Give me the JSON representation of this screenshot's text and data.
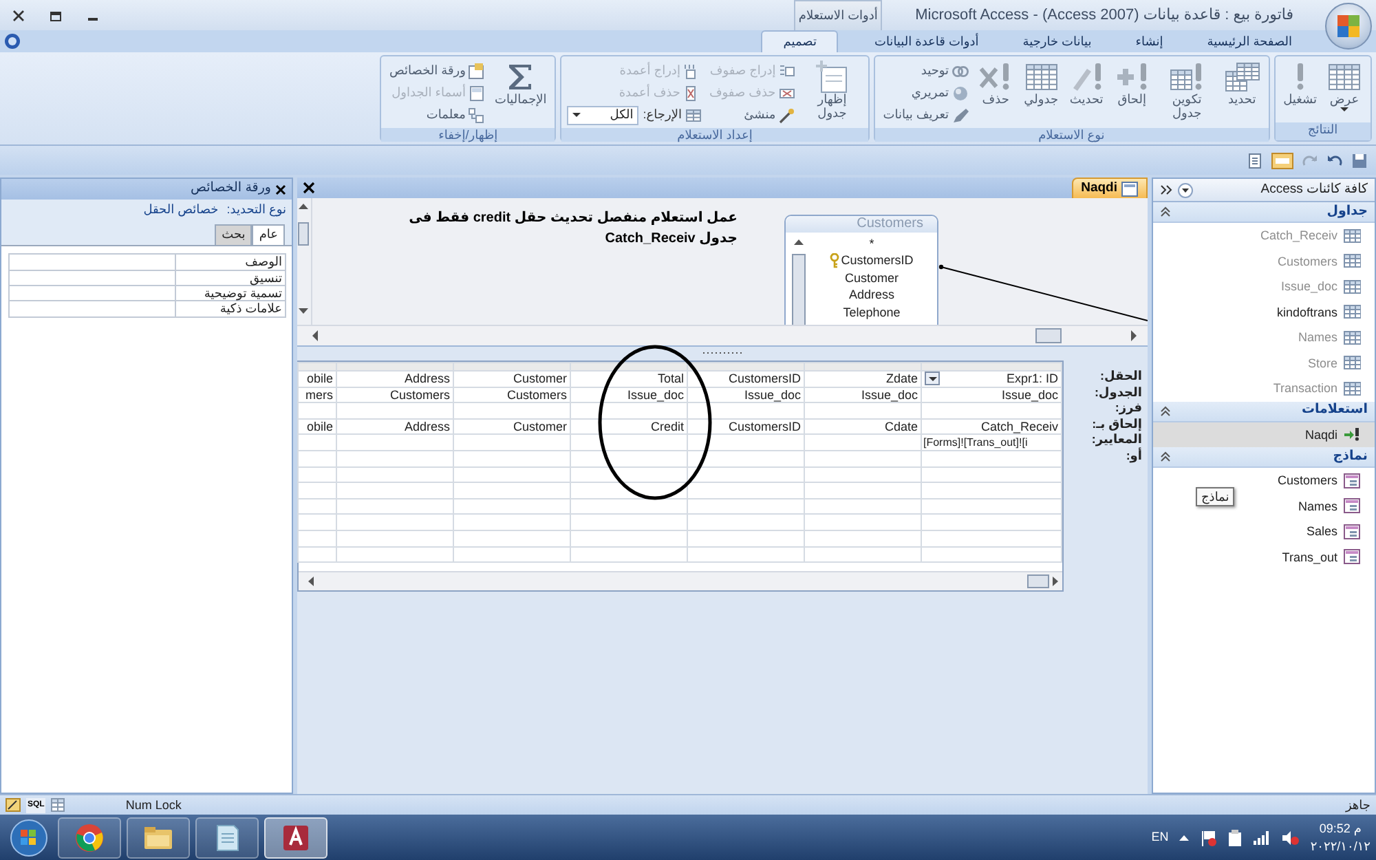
{
  "title_bar": {
    "title": "فاتورة بيع : قاعدة بيانات (Access 2007) - Microsoft Access",
    "context_label": "أدوات الاستعلام"
  },
  "ribbon_tabs": [
    {
      "label": "الصفحة الرئيسية",
      "selected": false
    },
    {
      "label": "إنشاء",
      "selected": false
    },
    {
      "label": "بيانات خارجية",
      "selected": false
    },
    {
      "label": "أدوات قاعدة البيانات",
      "selected": false
    },
    {
      "label": "تصميم",
      "selected": true
    }
  ],
  "ribbon_groups": [
    {
      "title": "النتائج",
      "items": [
        {
          "kind": "large",
          "label": "عرض",
          "dropdown": true,
          "disabled": false
        },
        {
          "kind": "large",
          "label": "تشغيل",
          "disabled": false
        }
      ]
    },
    {
      "title": "نوع الاستعلام",
      "items": [
        {
          "kind": "large",
          "label": "تحديد",
          "disabled": false
        },
        {
          "kind": "large",
          "label": "تكوين جدول",
          "disabled": false
        },
        {
          "kind": "large",
          "label": "إلحاق",
          "disabled": false
        },
        {
          "kind": "large",
          "label": "تحديث",
          "disabled": false
        },
        {
          "kind": "large",
          "label": "جدولي",
          "disabled": false
        },
        {
          "kind": "large",
          "label": "حذف",
          "disabled": false
        },
        {
          "kind": "small",
          "label": "توحيد",
          "disabled": false
        },
        {
          "kind": "small",
          "label": "تمريري",
          "disabled": false
        },
        {
          "kind": "small",
          "label": "تعريف بيانات",
          "disabled": false
        }
      ]
    },
    {
      "title": "إعداد الاستعلام",
      "items": [
        {
          "kind": "large",
          "label": "إظهار جدول",
          "disabled": false
        },
        {
          "kind": "small",
          "label": "إدراج صفوف",
          "disabled": true
        },
        {
          "kind": "small",
          "label": "حذف صفوف",
          "disabled": true
        },
        {
          "kind": "small",
          "label": "منشئ",
          "disabled": false
        },
        {
          "kind": "small",
          "label": "إدراج أعمدة",
          "disabled": true
        },
        {
          "kind": "small",
          "label": "حذف أعمدة",
          "disabled": true
        },
        {
          "kind": "combo",
          "label": "الإرجاع:",
          "value": "الكل"
        }
      ]
    },
    {
      "title": "إظهار/إخفاء",
      "items": [
        {
          "kind": "large",
          "label": "الإجماليات",
          "disabled": false
        },
        {
          "kind": "small",
          "label": "ورقة الخصائص",
          "disabled": false
        },
        {
          "kind": "small",
          "label": "أسماء الجداول",
          "disabled": true
        },
        {
          "kind": "small",
          "label": "معلمات",
          "disabled": false
        }
      ]
    }
  ],
  "document": {
    "tab": "Naqdi",
    "note": "عمل استعلام منفصل تحديث حقل credit فقط فى جدول Catch_Receiv",
    "table_box": {
      "title": "Customers",
      "fields": [
        {
          "name": "*",
          "key": false
        },
        {
          "name": "CustomersID",
          "key": true
        },
        {
          "name": "Customer",
          "key": false
        },
        {
          "name": "Address",
          "key": false
        },
        {
          "name": "Telephone",
          "key": false
        }
      ]
    },
    "grid": {
      "row_labels": [
        "الحقل:",
        "الجدول:",
        "فرز:",
        "إلحاق بـ:",
        "المعايير:",
        "أو:"
      ],
      "columns": [
        {
          "field": "Expr1: ID",
          "table": "Issue_doc",
          "append_to": "Catch_Receiv",
          "criteria": "[Forms]![Trans_out]![i",
          "selected": true
        },
        {
          "field": "Zdate",
          "table": "Issue_doc",
          "append_to": "Cdate",
          "selected": false
        },
        {
          "field": "CustomersID",
          "table": "Issue_doc",
          "append_to": "CustomersID",
          "selected": false
        },
        {
          "field": "Total",
          "table": "Issue_doc",
          "append_to": "Credit",
          "selected": false
        },
        {
          "field": "Customer",
          "table": "Customers",
          "append_to": "Customer",
          "selected": false
        },
        {
          "field": "Address",
          "table": "Customers",
          "append_to": "Address",
          "selected": false
        },
        {
          "field": "obile",
          "table": "mers",
          "append_to": "obile",
          "selected": false
        }
      ]
    }
  },
  "nav_pane": {
    "title": "كافة كائنات Access",
    "tooltip": "نماذج",
    "groups": [
      {
        "title": "جداول",
        "kind": "table",
        "items": [
          {
            "label": "Catch_Receiv",
            "dimmed": true,
            "selected": false
          },
          {
            "label": "Customers",
            "dimmed": true,
            "selected": false
          },
          {
            "label": "Issue_doc",
            "dimmed": true,
            "selected": false
          },
          {
            "label": "kindoftrans",
            "dimmed": false,
            "selected": false
          },
          {
            "label": "Names",
            "dimmed": true,
            "selected": false
          },
          {
            "label": "Store",
            "dimmed": true,
            "selected": false
          },
          {
            "label": "Transaction",
            "dimmed": true,
            "selected": false
          }
        ]
      },
      {
        "title": "استعلامات",
        "kind": "query",
        "items": [
          {
            "label": "Naqdi",
            "dimmed": false,
            "selected": true
          }
        ]
      },
      {
        "title": "نماذج",
        "kind": "form",
        "items": [
          {
            "label": "Customers",
            "dimmed": false,
            "selected": false
          },
          {
            "label": "Names",
            "dimmed": false,
            "selected": false
          },
          {
            "label": "Sales",
            "dimmed": false,
            "selected": false
          },
          {
            "label": "Trans_out",
            "dimmed": false,
            "selected": false
          }
        ]
      }
    ]
  },
  "property_sheet": {
    "title": "ورقة الخصائص",
    "selection_label": "نوع التحديد:",
    "selection_value": "خصائص الحقل",
    "tabs": [
      {
        "label": "عام",
        "selected": true
      },
      {
        "label": "بحث",
        "selected": false
      }
    ],
    "rows": [
      "الوصف",
      "تنسيق",
      "تسمية توضيحية",
      "علامات ذكية"
    ]
  },
  "status_bar": {
    "status": "جاهز",
    "indicator": "Num Lock",
    "sql_button": "SQL"
  },
  "taskbar": {
    "apps": [
      {
        "active": false
      },
      {
        "active": false
      },
      {
        "active": false
      },
      {
        "active": true
      }
    ],
    "language": "EN",
    "time": "09:52 م",
    "date": "٢٠٢٢/١٠/١٢"
  }
}
